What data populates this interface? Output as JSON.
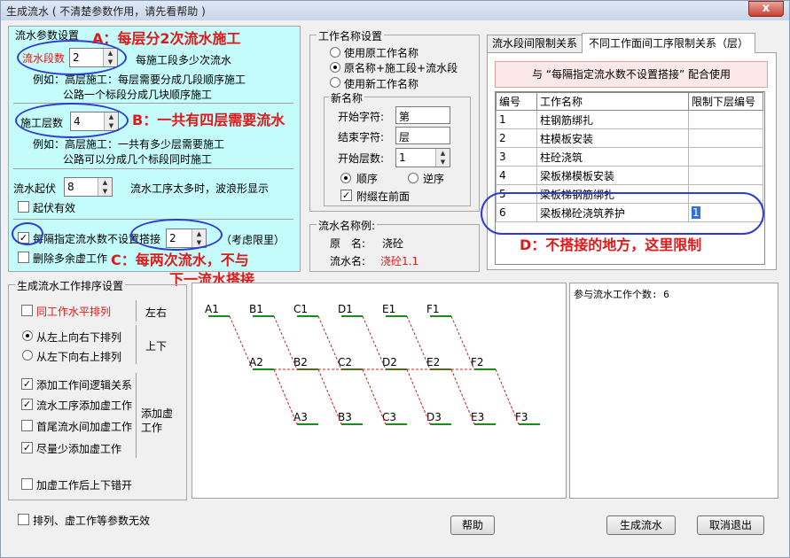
{
  "window": {
    "title": "生成流水 ( 不清楚参数作用，请先看帮助 )",
    "close": "x"
  },
  "params": {
    "group_title": "流水参数设置",
    "segments": {
      "label": "流水段数",
      "value": "2",
      "hint": "每施工段多少次流水",
      "ex1": "例如：高层施工：每层需要分成几段顺序施工",
      "ex2": "公路一个标段分成几块顺序施工"
    },
    "floors": {
      "label": "施工层数",
      "value": "4",
      "ex1": "例如：高层施工：一共有多少层需要施工",
      "ex2": "公路可以分成几个标段同时施工"
    },
    "rise": {
      "label": "流水起伏",
      "value": "8",
      "hint": "流水工序太多时，波浪形显示"
    },
    "rise_valid": {
      "label": "起伏有效",
      "checked": false
    },
    "interval": {
      "label": "每隔指定流水数不设置搭接",
      "value": "2",
      "hint": "（考虑限里）",
      "checked": true
    },
    "delete_virtual": {
      "label": "删除多余虚工作",
      "checked": false
    }
  },
  "annotations": {
    "a": "A：每层分2次流水施工",
    "b": "B：一共有四层需要流水",
    "c1": "C：每两次流水，不与",
    "c2": "下一流水搭接",
    "d": "D：不搭接的地方，这里限制"
  },
  "naming": {
    "group_title": "工作名称设置",
    "options": [
      {
        "label": "使用原工作名称",
        "on": false
      },
      {
        "label": "原名称+施工段+流水段",
        "on": true
      },
      {
        "label": "使用新工作名称",
        "on": false
      }
    ],
    "new_title": "新名称",
    "start_label": "开始字符:",
    "start_value": "第",
    "end_label": "结束字符:",
    "end_value": "层",
    "start_floor_label": "开始层数:",
    "start_floor_value": "1",
    "order_label": "顺序",
    "reverse_label": "逆序",
    "attach_label": "附缀在前面"
  },
  "example": {
    "title": "流水名称例:",
    "orig_label": "原　名:",
    "orig_value": "浇砼",
    "flow_label": "流水名:",
    "flow_value": "浇砼1.1"
  },
  "tabs": [
    "流水段间限制关系",
    "不同工作面间工序限制关系（层）"
  ],
  "limit": {
    "note": "与 “每隔指定流水数不设置搭接” 配合使用",
    "headers": [
      "编号",
      "工作名称",
      "限制下层编号"
    ],
    "rows": [
      [
        "1",
        "柱钢筋绑扎",
        ""
      ],
      [
        "2",
        "柱模板安装",
        ""
      ],
      [
        "3",
        "柱砼浇筑",
        ""
      ],
      [
        "4",
        "梁板梯模板安装",
        ""
      ],
      [
        "5",
        "梁板梯钢筋绑扎",
        ""
      ],
      [
        "6",
        "梁板梯砼浇筑养护",
        "1"
      ]
    ]
  },
  "sort": {
    "group_title": "生成流水工作排序设置",
    "same_level": {
      "label": "同工作水平排列",
      "checked": false
    },
    "lr": "左右",
    "opt1": "从左上向右下排列",
    "opt2": "从左下向右上排列",
    "ud": "上下",
    "c1": "添加工作间逻辑关系",
    "c2": "流水工序添加虚工作",
    "c3": "首尾流水间加虚工作",
    "c4": "尽量少添加虚工作",
    "add_virtual": "添加虚工作",
    "c5": "加虚工作后上下错开"
  },
  "diagram": {
    "row1": [
      "A1",
      "B1",
      "C1",
      "D1",
      "E1",
      "F1"
    ],
    "row2": [
      "A2",
      "B2",
      "C2",
      "D2",
      "E2",
      "F2"
    ],
    "row3": [
      "A3",
      "B3",
      "C3",
      "D3",
      "E3",
      "F3"
    ]
  },
  "count_label": "参与流水工作个数: 6",
  "footer": {
    "invalid_label": "排列、虚工作等参数无效",
    "help": "帮助",
    "generate": "生成流水",
    "cancel": "取消退出"
  },
  "colors": {
    "accent_red": "#e01818",
    "panel_cyan": "#c4fcfc",
    "oval_blue": "#2e3bd6",
    "node_green": "#1a8a1a"
  }
}
